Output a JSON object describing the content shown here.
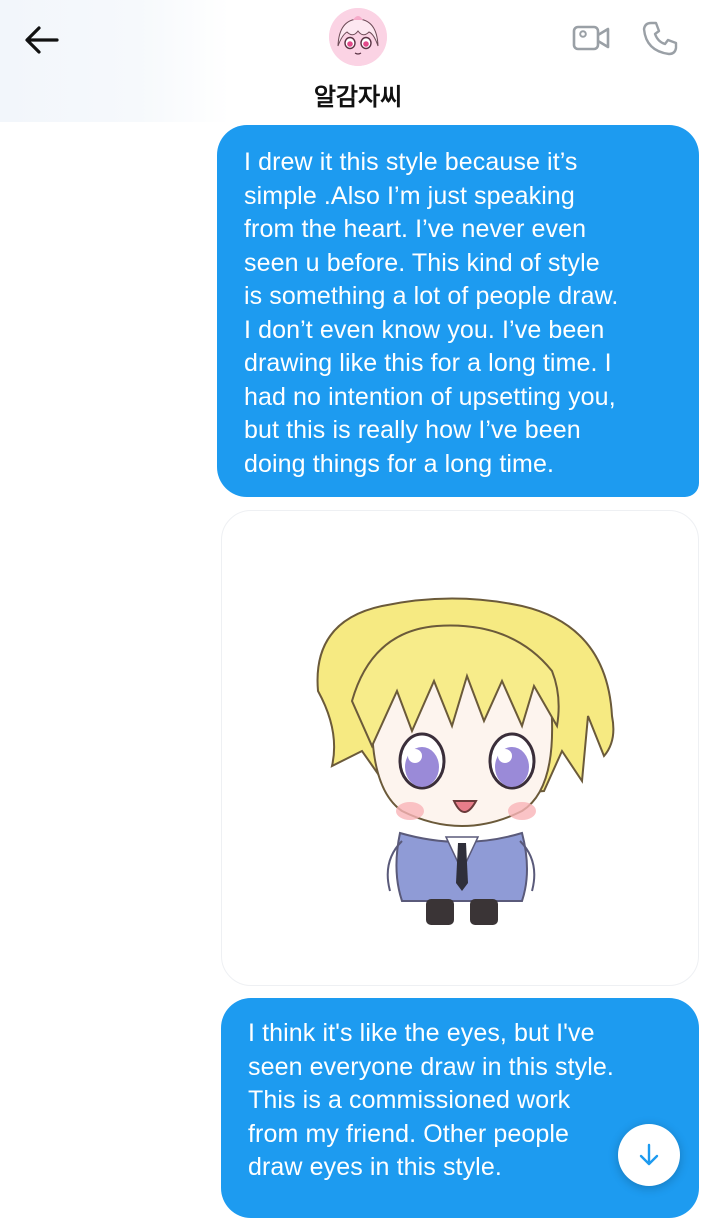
{
  "header": {
    "contact_name": "알감자씨",
    "back_icon": "arrow-left-icon",
    "video_icon": "video-camera-icon",
    "call_icon": "phone-icon"
  },
  "messages": [
    {
      "type": "text",
      "direction": "outgoing",
      "text": "I drew it this style because it’s\nsimple .Also I’m just speaking\nfrom the heart. I’ve never even\nseen u before. This kind of style\nis something a lot of people draw.\nI don’t even know you. I’ve been\ndrawing like this for a long time. I\nhad no intention of upsetting you,\nbut this is really how I’ve been\ndoing things for a long time."
    },
    {
      "type": "image",
      "direction": "outgoing",
      "subject": "chibi-character-illustration"
    },
    {
      "type": "text",
      "direction": "outgoing",
      "text": "I think it's like the eyes, but I've\nseen everyone draw in this style.\nThis is a commissioned work\nfrom my friend. Other people\ndraw eyes in this style."
    }
  ],
  "scroll_button": {
    "icon": "arrow-down-icon"
  },
  "colors": {
    "bubble": "#1d9bf0",
    "bubble_text": "#ffffff",
    "background": "#ffffff",
    "icon_gray": "#9aa0a6"
  }
}
